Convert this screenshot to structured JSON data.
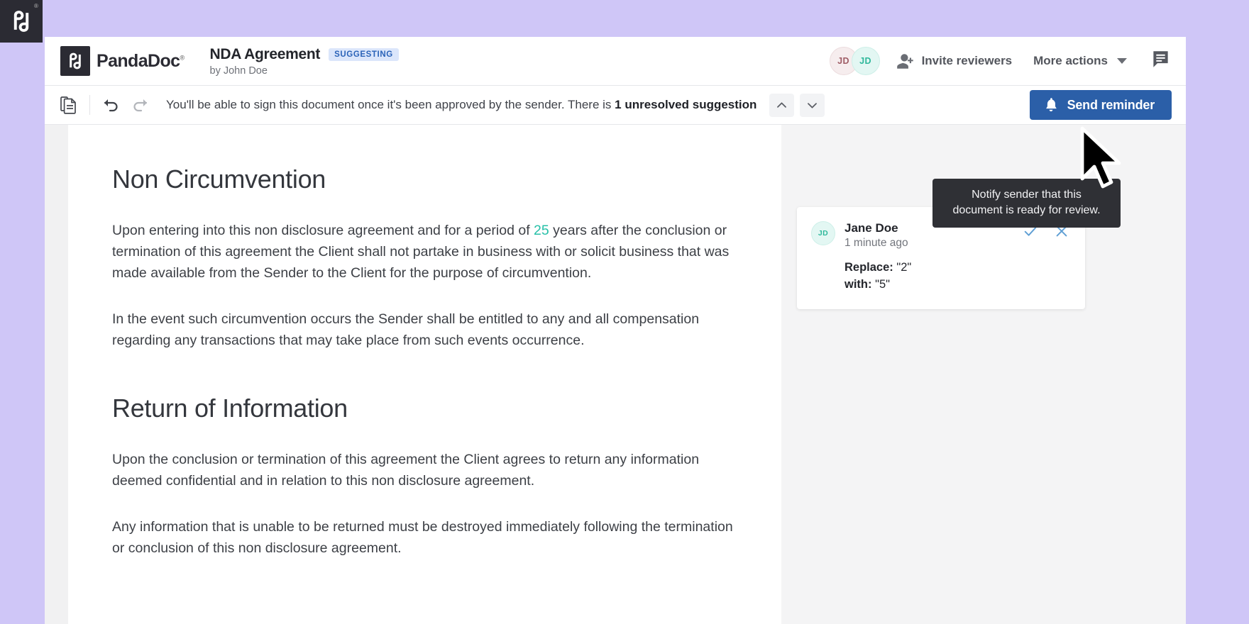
{
  "background": {
    "color": "#cfc6f7",
    "logo_icon": "pandadoc-logo-icon",
    "registered_mark": "®"
  },
  "header": {
    "brand_name": "PandaDoc",
    "brand_registered": "®",
    "brand_icon": "pandadoc-logo-icon",
    "doc_title": "NDA Agreement",
    "doc_mode_badge": "SUGGESTING",
    "doc_author": "by John Doe",
    "avatars": [
      {
        "initials": "JD",
        "color": "#9f5d66",
        "bg": "#f6edee"
      },
      {
        "initials": "JD",
        "color": "#2fb89b",
        "bg": "#e3f7f3"
      }
    ],
    "invite_reviewers_label": "Invite reviewers",
    "invite_reviewers_icon": "person-add-icon",
    "more_actions_label": "More actions",
    "more_actions_icon": "chevron-down-icon",
    "comments_icon": "comment-bubble-icon"
  },
  "toolbar": {
    "copy_icon": "copy-document-icon",
    "undo_icon": "undo-arrow-icon",
    "redo_icon": "redo-arrow-icon",
    "notice_prefix": "You'll be able to sign this document once it's been approved by the sender. There is ",
    "notice_bold": "1 unresolved suggestion",
    "prev_icon": "chevron-up-icon",
    "next_icon": "chevron-down-icon",
    "send_reminder_label": "Send reminder",
    "send_reminder_icon": "bell-icon",
    "send_reminder_color": "#2b5fa8"
  },
  "tooltip": {
    "text": "Notify sender that this document is ready for review.",
    "bg": "#2f3035"
  },
  "cursor": {
    "icon": "mouse-pointer-icon"
  },
  "document": {
    "sections": [
      {
        "heading": "Non Circumvention",
        "paragraphs": [
          {
            "pre": "Upon entering into this non disclosure agreement and for a period of ",
            "highlight": "25",
            "post": " years after the conclusion or termination of this agreement the Client shall not partake in business with or solicit business that was made available from the Sender to the Client for the purpose of circumvention."
          },
          {
            "pre": "In the event such circumvention occurs the Sender shall be entitled to any and all compensation regarding any transactions that may take place from such events occurrence.",
            "highlight": "",
            "post": ""
          }
        ]
      },
      {
        "heading": "Return of Information",
        "paragraphs": [
          {
            "pre": "Upon the conclusion or termination of this agreement the Client agrees to return any information deemed confidential and in relation to this non disclosure agreement.",
            "highlight": "",
            "post": ""
          },
          {
            "pre": "Any information that is unable to be returned must be destroyed immediately following the termination or conclusion of this non disclosure agreement.",
            "highlight": "",
            "post": ""
          }
        ]
      }
    ],
    "highlight_color": "#27c0a8"
  },
  "suggestion_card": {
    "avatar_initials": "JD",
    "author": "Jane Doe",
    "timestamp": "1 minute ago",
    "accept_icon": "check-icon",
    "reject_icon": "close-icon",
    "replace_label": "Replace:",
    "replace_value": "\"2\"",
    "with_label": "with:",
    "with_value": "\"5\""
  }
}
